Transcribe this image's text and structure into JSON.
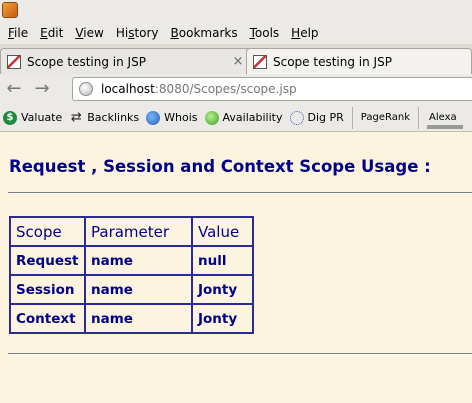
{
  "window": {
    "app_icon": "firefox-icon"
  },
  "menu": {
    "items": [
      {
        "accel": "F",
        "rest": "ile"
      },
      {
        "accel": "E",
        "rest": "dit"
      },
      {
        "accel": "V",
        "rest": "iew"
      },
      {
        "accel": "s",
        "pre": "Hi",
        "rest": "tory"
      },
      {
        "accel": "B",
        "rest": "ookmarks"
      },
      {
        "accel": "T",
        "rest": "ools"
      },
      {
        "accel": "H",
        "rest": "elp"
      }
    ]
  },
  "tabs": [
    {
      "label": "Scope testing in JSP",
      "close": "×"
    },
    {
      "label": "Scope testing in JSP"
    }
  ],
  "nav": {
    "back": "←",
    "forward": "→",
    "url_host": "localhost",
    "url_rest": ":8080/Scopes/scope.jsp"
  },
  "bookmarks": {
    "items": [
      {
        "label": "Valuate",
        "icon": "dollar-icon",
        "glyph": "$"
      },
      {
        "label": "Backlinks",
        "icon": "arrows-icon",
        "glyph": "⇄"
      },
      {
        "label": "Whois",
        "icon": "globe-icon",
        "glyph": ""
      },
      {
        "label": "Availability",
        "icon": "search-icon",
        "glyph": ""
      },
      {
        "label": "Dig PR",
        "icon": "network-icon",
        "glyph": ""
      }
    ],
    "pagerank": "PageRank",
    "alexa": "Alexa"
  },
  "page": {
    "heading": "Request , Session and Context Scope Usage :",
    "table": {
      "headers": [
        "Scope",
        "Parameter",
        "Value"
      ],
      "rows": [
        [
          "Request",
          "name",
          "null"
        ],
        [
          "Session",
          "name",
          "Jonty"
        ],
        [
          "Context",
          "name",
          "Jonty"
        ]
      ]
    }
  }
}
